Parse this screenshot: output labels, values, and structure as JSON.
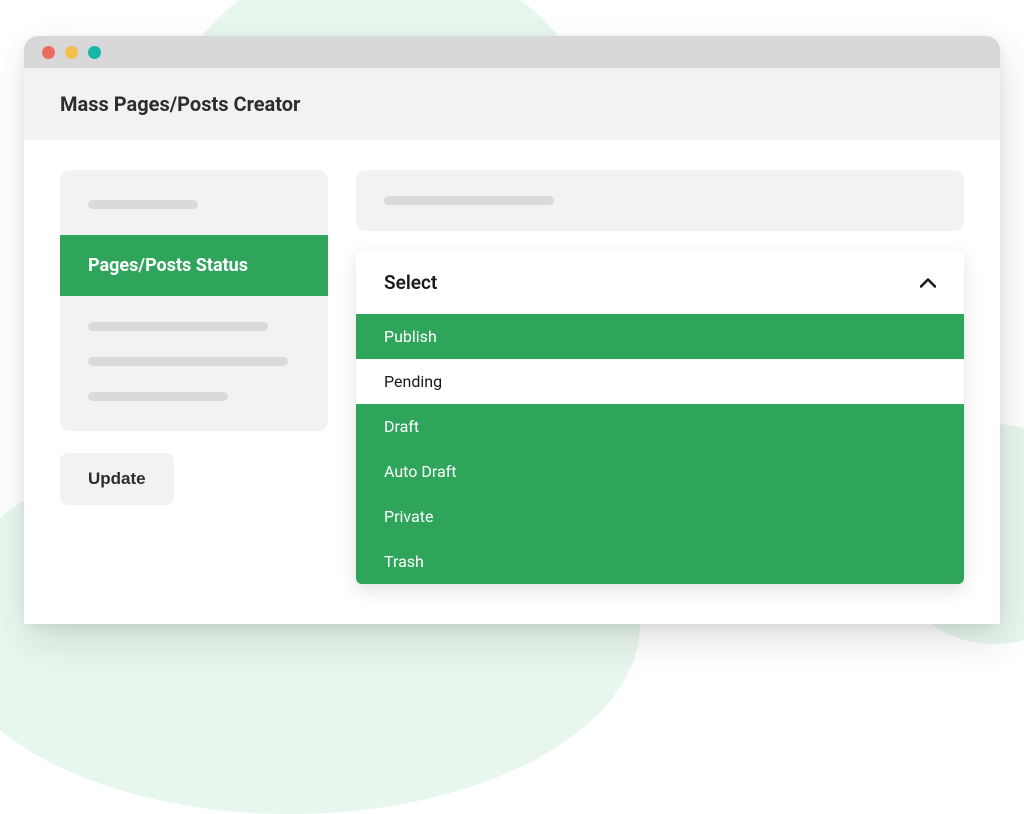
{
  "header": {
    "title": "Mass Pages/Posts Creator"
  },
  "sidebar": {
    "active_label": "Pages/Posts Status",
    "update_label": "Update"
  },
  "dropdown": {
    "label": "Select",
    "options": [
      {
        "label": "Publish",
        "selected": true
      },
      {
        "label": "Pending",
        "selected": false
      },
      {
        "label": "Draft",
        "selected": true
      },
      {
        "label": "Auto Draft",
        "selected": true
      },
      {
        "label": "Private",
        "selected": true
      },
      {
        "label": "Trash",
        "selected": true
      }
    ]
  },
  "colors": {
    "accent": "#2ea55a",
    "light_accent": "#e8f7ee"
  }
}
